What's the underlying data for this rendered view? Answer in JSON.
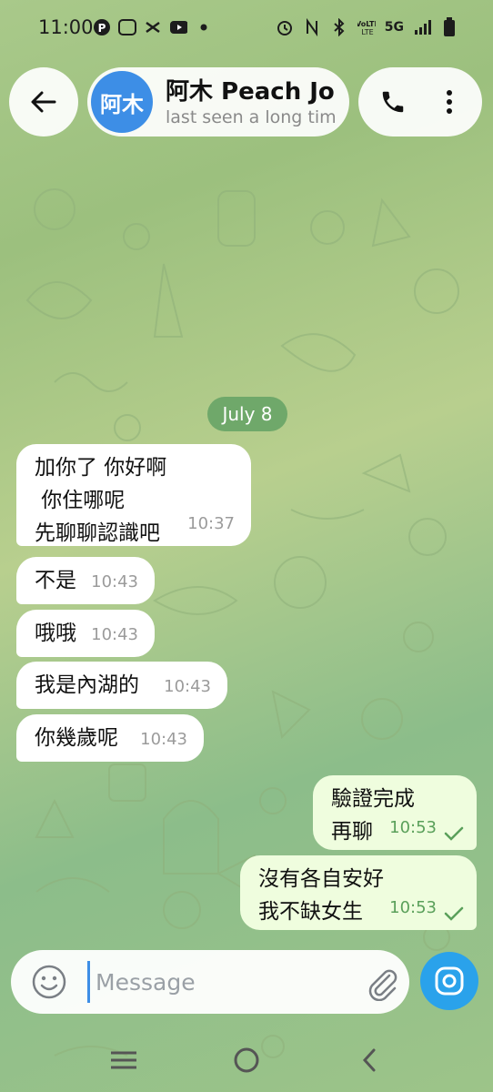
{
  "status_bar": {
    "time": "11:00",
    "network": "5G",
    "icons_left": [
      "p-app-icon",
      "line-app-icon",
      "capcut-icon",
      "youtube-icon",
      "dot-icon"
    ],
    "icons_right": [
      "alarm-icon",
      "nfc-icon",
      "bluetooth-icon",
      "volte-icon",
      "signal-icon",
      "battery-icon"
    ]
  },
  "header": {
    "avatar_text": "阿木",
    "contact_name": "阿木 Peach Jo",
    "contact_status": "last seen a long tim",
    "accent": "#3d8ee6"
  },
  "chat": {
    "date_label": "July 8",
    "messages": [
      {
        "dir": "in",
        "text": "加你了 你好啊\n 你住哪呢\n先聊聊認識吧",
        "time": "10:37"
      },
      {
        "dir": "in",
        "text": "不是",
        "time": "10:43"
      },
      {
        "dir": "in",
        "text": "哦哦",
        "time": "10:43"
      },
      {
        "dir": "in",
        "text": "我是內湖的",
        "time": "10:43"
      },
      {
        "dir": "in",
        "text": "你幾歲呢",
        "time": "10:43"
      },
      {
        "dir": "out",
        "text": "驗證完成\n再聊",
        "time": "10:53",
        "read": true
      },
      {
        "dir": "out",
        "text": "沒有各自安好\n我不缺女生",
        "time": "10:53",
        "read": true
      }
    ]
  },
  "composer": {
    "placeholder": "Message"
  },
  "colors": {
    "incoming_bubble": "#ffffff",
    "outgoing_bubble": "#effdde",
    "date_chip": "#6fa86a",
    "camera_button": "#2aa2eb"
  }
}
